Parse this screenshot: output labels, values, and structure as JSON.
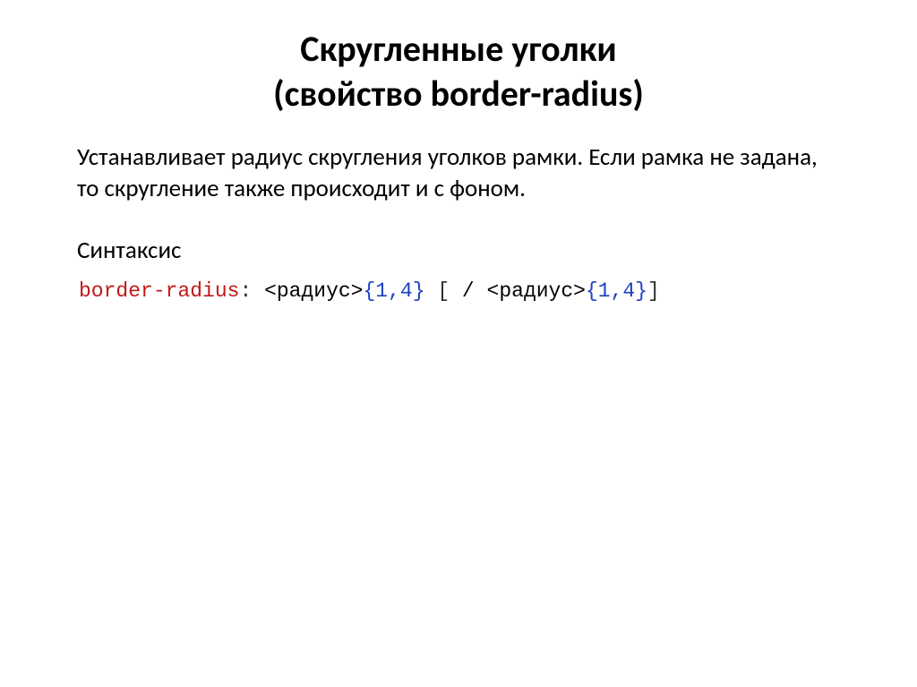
{
  "slide": {
    "title_line1": "Скругленные уголки",
    "title_line2": "(свойство border-radius)",
    "paragraph": "Устанавливает радиус скругления уголков рамки. Если рамка не задана, то скругление также происходит и с фоном.",
    "subheading": "Синтаксис",
    "code": {
      "property": "border-radius",
      "colon": ":",
      "space1": " ",
      "value1": "<радиус>",
      "range1": "{1,4}",
      "space2": " ",
      "bracket_open": "[",
      "mid": " / ",
      "value2": "<радиус>",
      "range2": "{1,4}",
      "bracket_close": "]"
    }
  }
}
